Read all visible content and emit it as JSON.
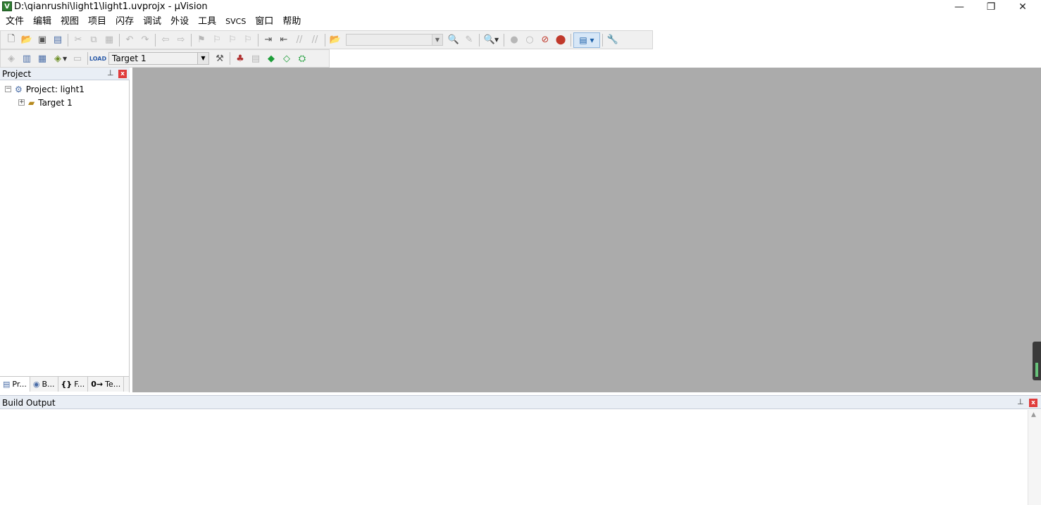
{
  "window": {
    "title": "D:\\qianrushi\\light1\\light1.uvprojx - µVision",
    "app_icon_letter": "V",
    "controls": {
      "minimize": "—",
      "restore": "❐",
      "close": "✕"
    }
  },
  "menu": [
    "文件",
    "编辑",
    "视图",
    "项目",
    "闪存",
    "调试",
    "外设",
    "工具",
    "SVCS",
    "窗口",
    "帮助"
  ],
  "toolbar2": {
    "target_select": "Target 1",
    "load_label": "LOAD"
  },
  "project_panel": {
    "title": "Project",
    "pin": "⊥",
    "close": "x",
    "tree": {
      "project_label": "Project: light1",
      "project_expander": "−",
      "target_label": "Target 1",
      "target_expander": "+"
    },
    "tabs": [
      {
        "label": "Pr...",
        "icon": "project-icon"
      },
      {
        "label": "B...",
        "icon": "books-icon"
      },
      {
        "label": "F...",
        "icon": "functions-icon",
        "glyph": "{}"
      },
      {
        "label": "Te...",
        "icon": "templates-icon",
        "glyph": "0→"
      }
    ]
  },
  "build_output": {
    "title": "Build Output",
    "pin": "⊥",
    "close": "x"
  },
  "colors": {
    "editor_background": "#ababab",
    "panel_header": "#e9eef5",
    "close_button": "#e03c3c"
  }
}
